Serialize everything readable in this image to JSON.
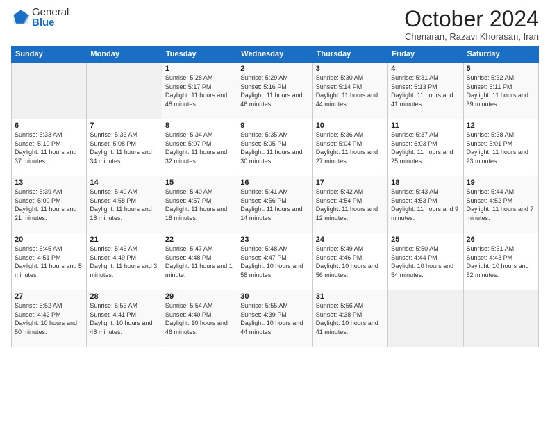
{
  "logo": {
    "general": "General",
    "blue": "Blue"
  },
  "header": {
    "title": "October 2024",
    "subtitle": "Chenaran, Razavi Khorasan, Iran"
  },
  "weekdays": [
    "Sunday",
    "Monday",
    "Tuesday",
    "Wednesday",
    "Thursday",
    "Friday",
    "Saturday"
  ],
  "weeks": [
    [
      {
        "day": "",
        "sunrise": "",
        "sunset": "",
        "daylight": ""
      },
      {
        "day": "",
        "sunrise": "",
        "sunset": "",
        "daylight": ""
      },
      {
        "day": "1",
        "sunrise": "Sunrise: 5:28 AM",
        "sunset": "Sunset: 5:17 PM",
        "daylight": "Daylight: 11 hours and 48 minutes."
      },
      {
        "day": "2",
        "sunrise": "Sunrise: 5:29 AM",
        "sunset": "Sunset: 5:16 PM",
        "daylight": "Daylight: 11 hours and 46 minutes."
      },
      {
        "day": "3",
        "sunrise": "Sunrise: 5:30 AM",
        "sunset": "Sunset: 5:14 PM",
        "daylight": "Daylight: 11 hours and 44 minutes."
      },
      {
        "day": "4",
        "sunrise": "Sunrise: 5:31 AM",
        "sunset": "Sunset: 5:13 PM",
        "daylight": "Daylight: 11 hours and 41 minutes."
      },
      {
        "day": "5",
        "sunrise": "Sunrise: 5:32 AM",
        "sunset": "Sunset: 5:11 PM",
        "daylight": "Daylight: 11 hours and 39 minutes."
      }
    ],
    [
      {
        "day": "6",
        "sunrise": "Sunrise: 5:33 AM",
        "sunset": "Sunset: 5:10 PM",
        "daylight": "Daylight: 11 hours and 37 minutes."
      },
      {
        "day": "7",
        "sunrise": "Sunrise: 5:33 AM",
        "sunset": "Sunset: 5:08 PM",
        "daylight": "Daylight: 11 hours and 34 minutes."
      },
      {
        "day": "8",
        "sunrise": "Sunrise: 5:34 AM",
        "sunset": "Sunset: 5:07 PM",
        "daylight": "Daylight: 11 hours and 32 minutes."
      },
      {
        "day": "9",
        "sunrise": "Sunrise: 5:35 AM",
        "sunset": "Sunset: 5:05 PM",
        "daylight": "Daylight: 11 hours and 30 minutes."
      },
      {
        "day": "10",
        "sunrise": "Sunrise: 5:36 AM",
        "sunset": "Sunset: 5:04 PM",
        "daylight": "Daylight: 11 hours and 27 minutes."
      },
      {
        "day": "11",
        "sunrise": "Sunrise: 5:37 AM",
        "sunset": "Sunset: 5:03 PM",
        "daylight": "Daylight: 11 hours and 25 minutes."
      },
      {
        "day": "12",
        "sunrise": "Sunrise: 5:38 AM",
        "sunset": "Sunset: 5:01 PM",
        "daylight": "Daylight: 11 hours and 23 minutes."
      }
    ],
    [
      {
        "day": "13",
        "sunrise": "Sunrise: 5:39 AM",
        "sunset": "Sunset: 5:00 PM",
        "daylight": "Daylight: 11 hours and 21 minutes."
      },
      {
        "day": "14",
        "sunrise": "Sunrise: 5:40 AM",
        "sunset": "Sunset: 4:58 PM",
        "daylight": "Daylight: 11 hours and 18 minutes."
      },
      {
        "day": "15",
        "sunrise": "Sunrise: 5:40 AM",
        "sunset": "Sunset: 4:57 PM",
        "daylight": "Daylight: 11 hours and 16 minutes."
      },
      {
        "day": "16",
        "sunrise": "Sunrise: 5:41 AM",
        "sunset": "Sunset: 4:56 PM",
        "daylight": "Daylight: 11 hours and 14 minutes."
      },
      {
        "day": "17",
        "sunrise": "Sunrise: 5:42 AM",
        "sunset": "Sunset: 4:54 PM",
        "daylight": "Daylight: 11 hours and 12 minutes."
      },
      {
        "day": "18",
        "sunrise": "Sunrise: 5:43 AM",
        "sunset": "Sunset: 4:53 PM",
        "daylight": "Daylight: 11 hours and 9 minutes."
      },
      {
        "day": "19",
        "sunrise": "Sunrise: 5:44 AM",
        "sunset": "Sunset: 4:52 PM",
        "daylight": "Daylight: 11 hours and 7 minutes."
      }
    ],
    [
      {
        "day": "20",
        "sunrise": "Sunrise: 5:45 AM",
        "sunset": "Sunset: 4:51 PM",
        "daylight": "Daylight: 11 hours and 5 minutes."
      },
      {
        "day": "21",
        "sunrise": "Sunrise: 5:46 AM",
        "sunset": "Sunset: 4:49 PM",
        "daylight": "Daylight: 11 hours and 3 minutes."
      },
      {
        "day": "22",
        "sunrise": "Sunrise: 5:47 AM",
        "sunset": "Sunset: 4:48 PM",
        "daylight": "Daylight: 11 hours and 1 minute."
      },
      {
        "day": "23",
        "sunrise": "Sunrise: 5:48 AM",
        "sunset": "Sunset: 4:47 PM",
        "daylight": "Daylight: 10 hours and 58 minutes."
      },
      {
        "day": "24",
        "sunrise": "Sunrise: 5:49 AM",
        "sunset": "Sunset: 4:46 PM",
        "daylight": "Daylight: 10 hours and 56 minutes."
      },
      {
        "day": "25",
        "sunrise": "Sunrise: 5:50 AM",
        "sunset": "Sunset: 4:44 PM",
        "daylight": "Daylight: 10 hours and 54 minutes."
      },
      {
        "day": "26",
        "sunrise": "Sunrise: 5:51 AM",
        "sunset": "Sunset: 4:43 PM",
        "daylight": "Daylight: 10 hours and 52 minutes."
      }
    ],
    [
      {
        "day": "27",
        "sunrise": "Sunrise: 5:52 AM",
        "sunset": "Sunset: 4:42 PM",
        "daylight": "Daylight: 10 hours and 50 minutes."
      },
      {
        "day": "28",
        "sunrise": "Sunrise: 5:53 AM",
        "sunset": "Sunset: 4:41 PM",
        "daylight": "Daylight: 10 hours and 48 minutes."
      },
      {
        "day": "29",
        "sunrise": "Sunrise: 5:54 AM",
        "sunset": "Sunset: 4:40 PM",
        "daylight": "Daylight: 10 hours and 46 minutes."
      },
      {
        "day": "30",
        "sunrise": "Sunrise: 5:55 AM",
        "sunset": "Sunset: 4:39 PM",
        "daylight": "Daylight: 10 hours and 44 minutes."
      },
      {
        "day": "31",
        "sunrise": "Sunrise: 5:56 AM",
        "sunset": "Sunset: 4:38 PM",
        "daylight": "Daylight: 10 hours and 41 minutes."
      },
      {
        "day": "",
        "sunrise": "",
        "sunset": "",
        "daylight": ""
      },
      {
        "day": "",
        "sunrise": "",
        "sunset": "",
        "daylight": ""
      }
    ]
  ]
}
